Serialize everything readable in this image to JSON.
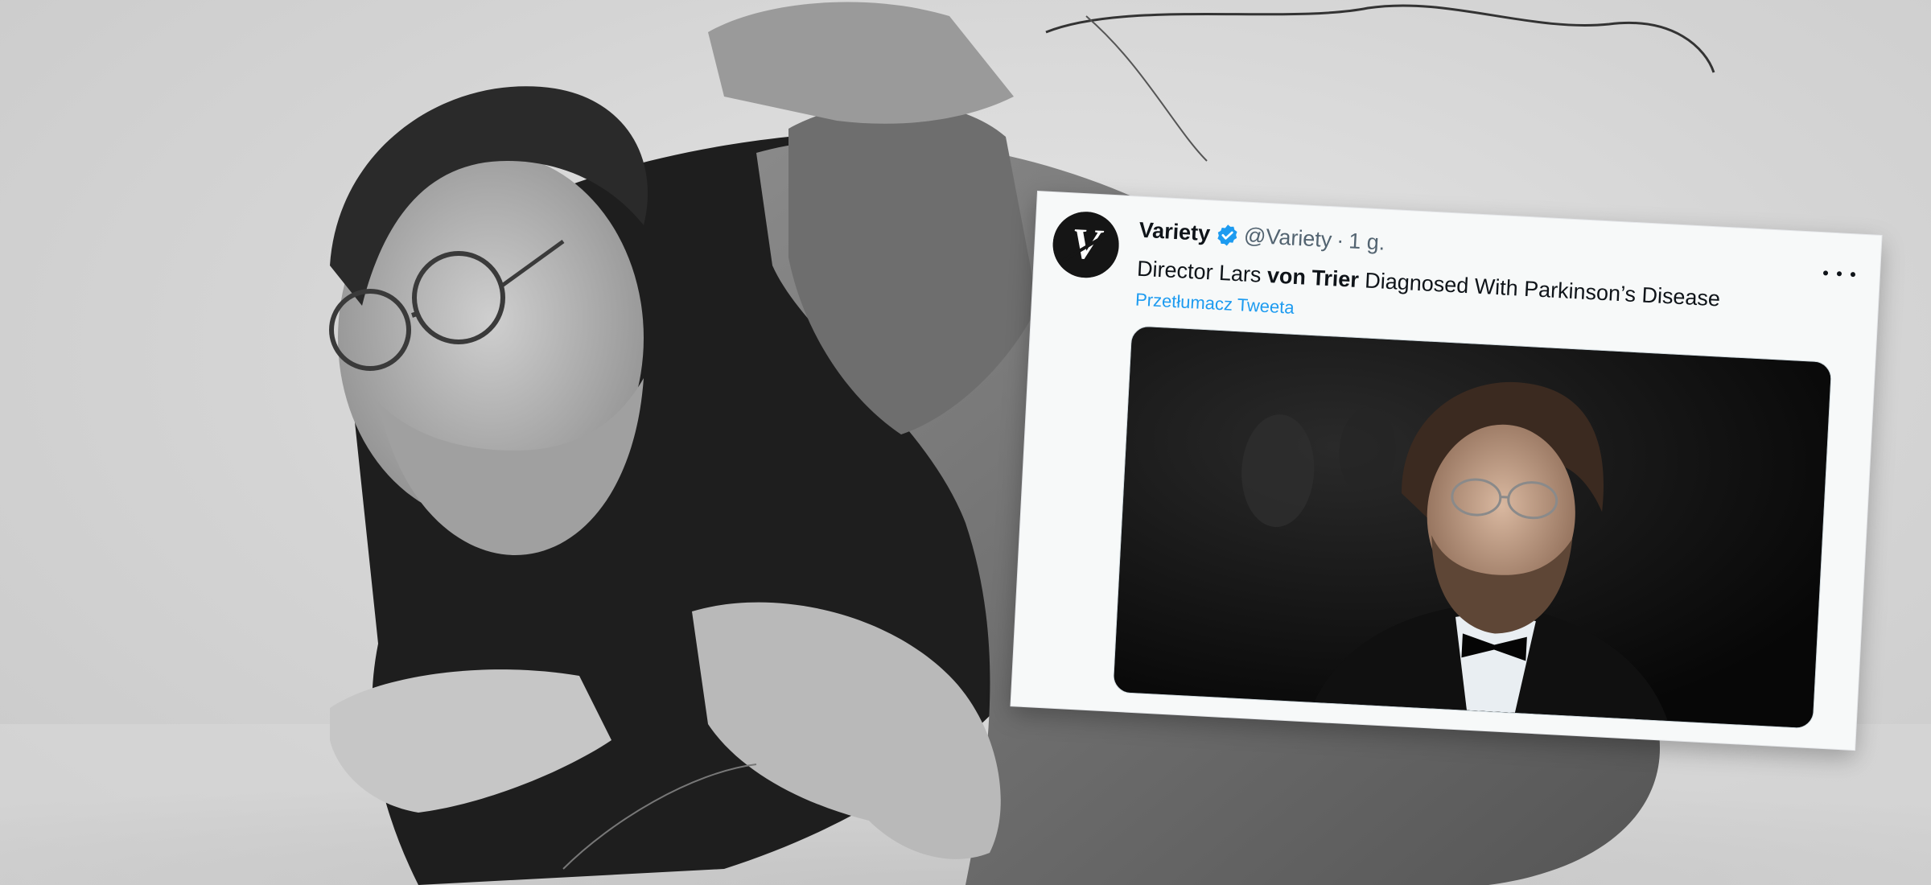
{
  "tweet": {
    "author_name": "Variety",
    "handle": "@Variety",
    "separator": "·",
    "time": "1 g.",
    "text_before": "Director Lars ",
    "text_bold": "von Trier",
    "text_after": " Diagnosed With Parkinson’s Disease",
    "translate_label": "Przetłumacz Tweeta",
    "avatar_letter": "V"
  },
  "colors": {
    "link": "#1d9bf0",
    "verified": "#1d9bf0",
    "text": "#0f1419",
    "secondary": "#536471"
  },
  "icons": {
    "verified": "verified-badge-icon",
    "more": "more-options-icon"
  }
}
